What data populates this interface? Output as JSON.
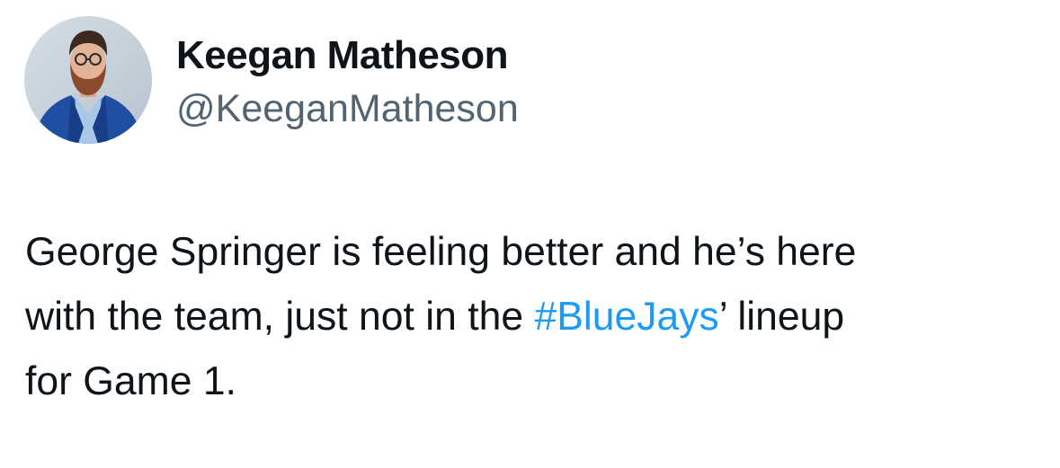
{
  "author": {
    "name": "Keegan Matheson",
    "handle": "@KeeganMatheson",
    "avatar_icon": "profile-photo-avatar"
  },
  "tweet": {
    "line1": "George Springer is feeling better and he’s here",
    "line2_before": "with the team, just not in the ",
    "hashtag": "#BlueJays",
    "line2_after": "’ lineup",
    "line3": "for Game 1."
  },
  "colors": {
    "text": "#0f1419",
    "secondary": "#536471",
    "link": "#1d9bf0",
    "avatar_bg": "#c9d3dc",
    "suit": "#1f4fa3"
  }
}
